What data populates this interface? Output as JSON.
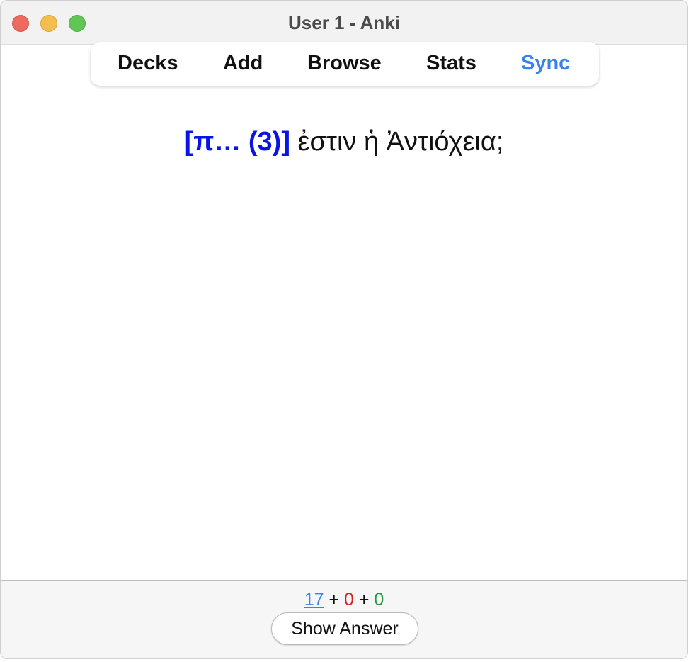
{
  "window": {
    "title": "User 1 - Anki"
  },
  "toolbar": {
    "decks": "Decks",
    "add": "Add",
    "browse": "Browse",
    "stats": "Stats",
    "sync": "Sync",
    "sync_color": "#3b82e8"
  },
  "card": {
    "cloze": "[π… (3)]",
    "text": " ἐστιν ἡ Ἀντιόχεια;",
    "cloze_color": "#0a14e6"
  },
  "bottom": {
    "counts": {
      "new": "17",
      "plus1": " + ",
      "learn": "0",
      "plus2": " + ",
      "review": "0"
    },
    "count_colors": {
      "new": "#3b82e8",
      "learn": "#d32222",
      "review": "#1e9a3c"
    },
    "show_answer": "Show Answer"
  }
}
